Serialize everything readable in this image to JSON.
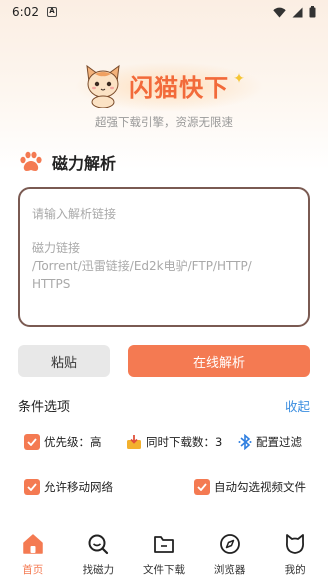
{
  "status_bar": {
    "time": "6:02",
    "notification_icon": "A"
  },
  "brand": {
    "title": "闪猫快下",
    "subtitle": "超强下载引擎，资源无限速",
    "accent_color": "#f26a3a"
  },
  "magnet_section": {
    "title": "磁力解析",
    "input_placeholder_line1": "请输入解析链接",
    "input_placeholder_line2": "磁力链接",
    "input_placeholder_line3": "/Torrent/迅雷链接/Ed2k电驴/FTP/HTTP/",
    "input_placeholder_line4": "HTTPS"
  },
  "buttons": {
    "paste": "粘贴",
    "parse_online": "在线解析",
    "parse_color": "#f47a52"
  },
  "conditions": {
    "title": "条件选项",
    "collapse": "收起",
    "priority": "优先级：高",
    "concurrent": "同时下载数：3",
    "filter": "配置过滤",
    "mobile_network": "允许移动网络",
    "auto_select_video": "自动勾选视频文件"
  },
  "nav": {
    "items": [
      {
        "label": "首页",
        "icon": "home-icon",
        "active": true
      },
      {
        "label": "找磁力",
        "icon": "search-icon",
        "active": false
      },
      {
        "label": "文件下载",
        "icon": "folder-icon",
        "active": false
      },
      {
        "label": "浏览器",
        "icon": "compass-icon",
        "active": false
      },
      {
        "label": "我的",
        "icon": "cat-face-icon",
        "active": false
      }
    ]
  }
}
